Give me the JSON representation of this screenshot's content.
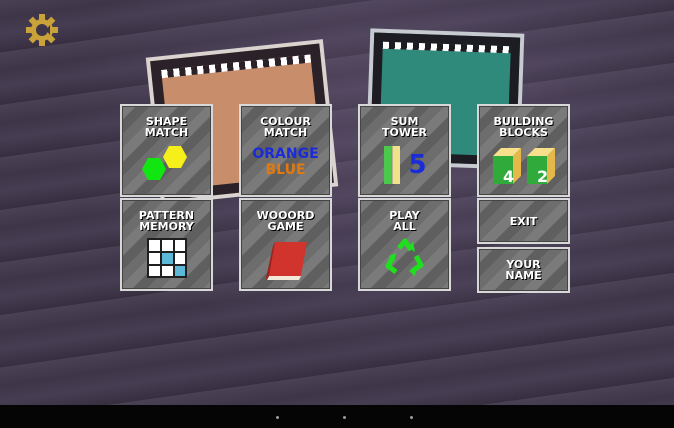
{
  "menu": {
    "shape_match": "SHAPE\nMATCH",
    "colour_match": "COLOUR\nMATCH",
    "colour_word1": "ORANGE",
    "colour_word2": "BLUE",
    "sum_tower": "SUM\nTOWER",
    "sum_digit": "5",
    "building_blocks": "BUILDING\nBLOCKS",
    "block_digit1": "4",
    "block_digit2": "2",
    "pattern_memory": "PATTERN\nMEMORY",
    "wooord_game": "WOOORD\nGAME",
    "play_all": "PLAY\nALL",
    "exit": "EXIT",
    "your_name": "YOUR\nNAME"
  },
  "colors": {
    "word1": "#1a2bd9",
    "word2": "#e07a10",
    "hex_green": "#12e612",
    "hex_yellow": "#f5ef1a",
    "recycle": "#1ee01e",
    "book": "#d0342c",
    "gear": "#c9a23a"
  },
  "icons": [
    "settings-gear-icon",
    "hexagons-icon",
    "tower-icon",
    "blocks-icon",
    "grid-icon",
    "book-icon",
    "recycle-icon"
  ]
}
